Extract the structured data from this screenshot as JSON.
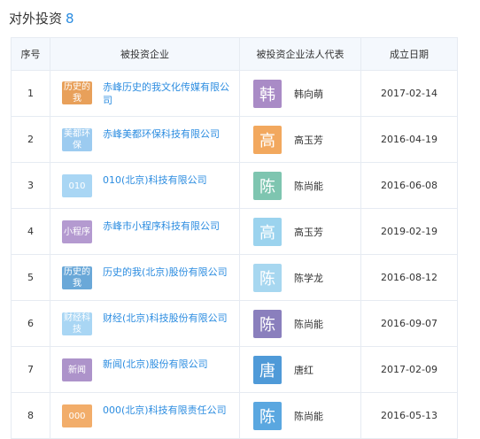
{
  "section": {
    "title": "对外投资",
    "count": "8"
  },
  "columns": [
    "序号",
    "被投资企业",
    "被投资企业法人代表",
    "成立日期"
  ],
  "rows": [
    {
      "idx": "1",
      "logo_text": "历史的我",
      "logo_color": "#e8a05a",
      "company": "赤峰历史的我文化传媒有限公司",
      "avatar_char": "韩",
      "avatar_color": "#a98bc6",
      "person": "韩向萌",
      "date": "2017-02-14"
    },
    {
      "idx": "2",
      "logo_text": "美都环保",
      "logo_color": "#9ccbf0",
      "company": "赤峰美都环保科技有限公司",
      "avatar_char": "高",
      "avatar_color": "#f2a85e",
      "person": "高玉芳",
      "date": "2016-04-19"
    },
    {
      "idx": "3",
      "logo_text": "010",
      "logo_color": "#a9d6f4",
      "company": "010(北京)科技有限公司",
      "avatar_char": "陈",
      "avatar_color": "#7ec5b0",
      "person": "陈尚能",
      "date": "2016-06-08"
    },
    {
      "idx": "4",
      "logo_text": "小程序",
      "logo_color": "#b49ad0",
      "company": "赤峰市小程序科技有限公司",
      "avatar_char": "高",
      "avatar_color": "#9bd3ee",
      "person": "高玉芳",
      "date": "2019-02-19"
    },
    {
      "idx": "5",
      "logo_text": "历史的我",
      "logo_color": "#6aa8d8",
      "company": "历史的我(北京)股份有限公司",
      "avatar_char": "陈",
      "avatar_color": "#a7d7f0",
      "person": "陈学龙",
      "date": "2016-08-12"
    },
    {
      "idx": "6",
      "logo_text": "财经科技",
      "logo_color": "#a9d6f4",
      "company": "财经(北京)科技股份有限公司",
      "avatar_char": "陈",
      "avatar_color": "#8a7fbd",
      "person": "陈尚能",
      "date": "2016-09-07"
    },
    {
      "idx": "7",
      "logo_text": "新闻",
      "logo_color": "#ad93ca",
      "company": "新闻(北京)股份有限公司",
      "avatar_char": "唐",
      "avatar_color": "#4f9ad8",
      "person": "唐红",
      "date": "2017-02-09"
    },
    {
      "idx": "8",
      "logo_text": "000",
      "logo_color": "#f2ad6a",
      "company": "000(北京)科技有限责任公司",
      "avatar_char": "陈",
      "avatar_color": "#5aa7e0",
      "person": "陈尚能",
      "date": "2016-05-13"
    }
  ]
}
